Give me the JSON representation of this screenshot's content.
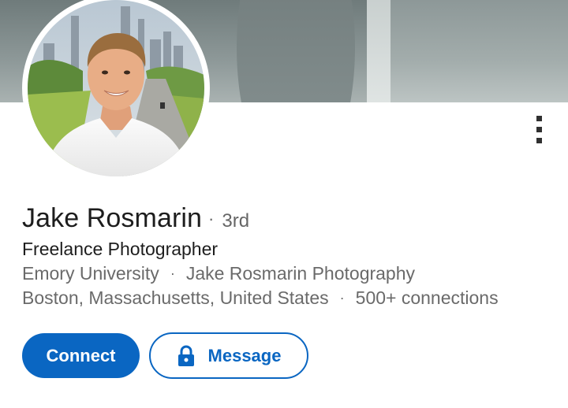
{
  "profile": {
    "name": "Jake Rosmarin",
    "separator": "·",
    "degree": "3rd",
    "headline": "Freelance Photographer",
    "education": "Emory University",
    "company": "Jake Rosmarin Photography",
    "location": "Boston, Massachusetts, United States",
    "connections": "500+ connections"
  },
  "actions": {
    "connect_label": "Connect",
    "message_label": "Message",
    "message_icon": "lock-icon",
    "more_icon": "more-vertical-icon"
  },
  "colors": {
    "accent": "#0a66c2",
    "text_primary": "#1d1d1d",
    "text_secondary": "#6a6a6a"
  }
}
